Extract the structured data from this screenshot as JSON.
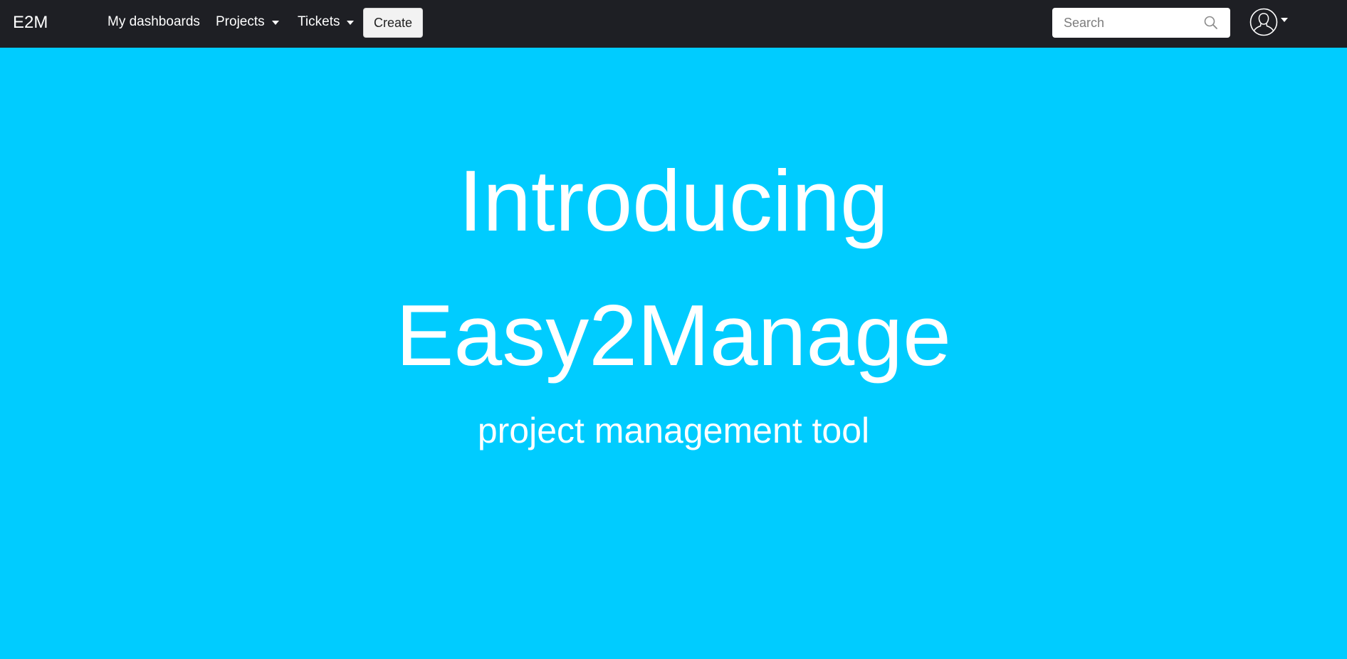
{
  "navbar": {
    "brand": "E2M",
    "items": [
      {
        "label": "My dashboards"
      },
      {
        "label": "Projects"
      },
      {
        "label": "Tickets"
      }
    ],
    "create_label": "Create",
    "search": {
      "placeholder": "Search",
      "value": ""
    },
    "icons": {
      "search": "search-icon",
      "avatar": "user-avatar-icon",
      "dropdown": "caret-down-icon"
    }
  },
  "hero": {
    "title_line1": "Introducing",
    "title_line2": "Easy2Manage",
    "subtitle": "project management tool"
  },
  "colors": {
    "navbar_bg": "#1e1f24",
    "hero_bg": "#00ccff",
    "text_light": "#ffffff",
    "button_bg": "#f2f2f2"
  }
}
